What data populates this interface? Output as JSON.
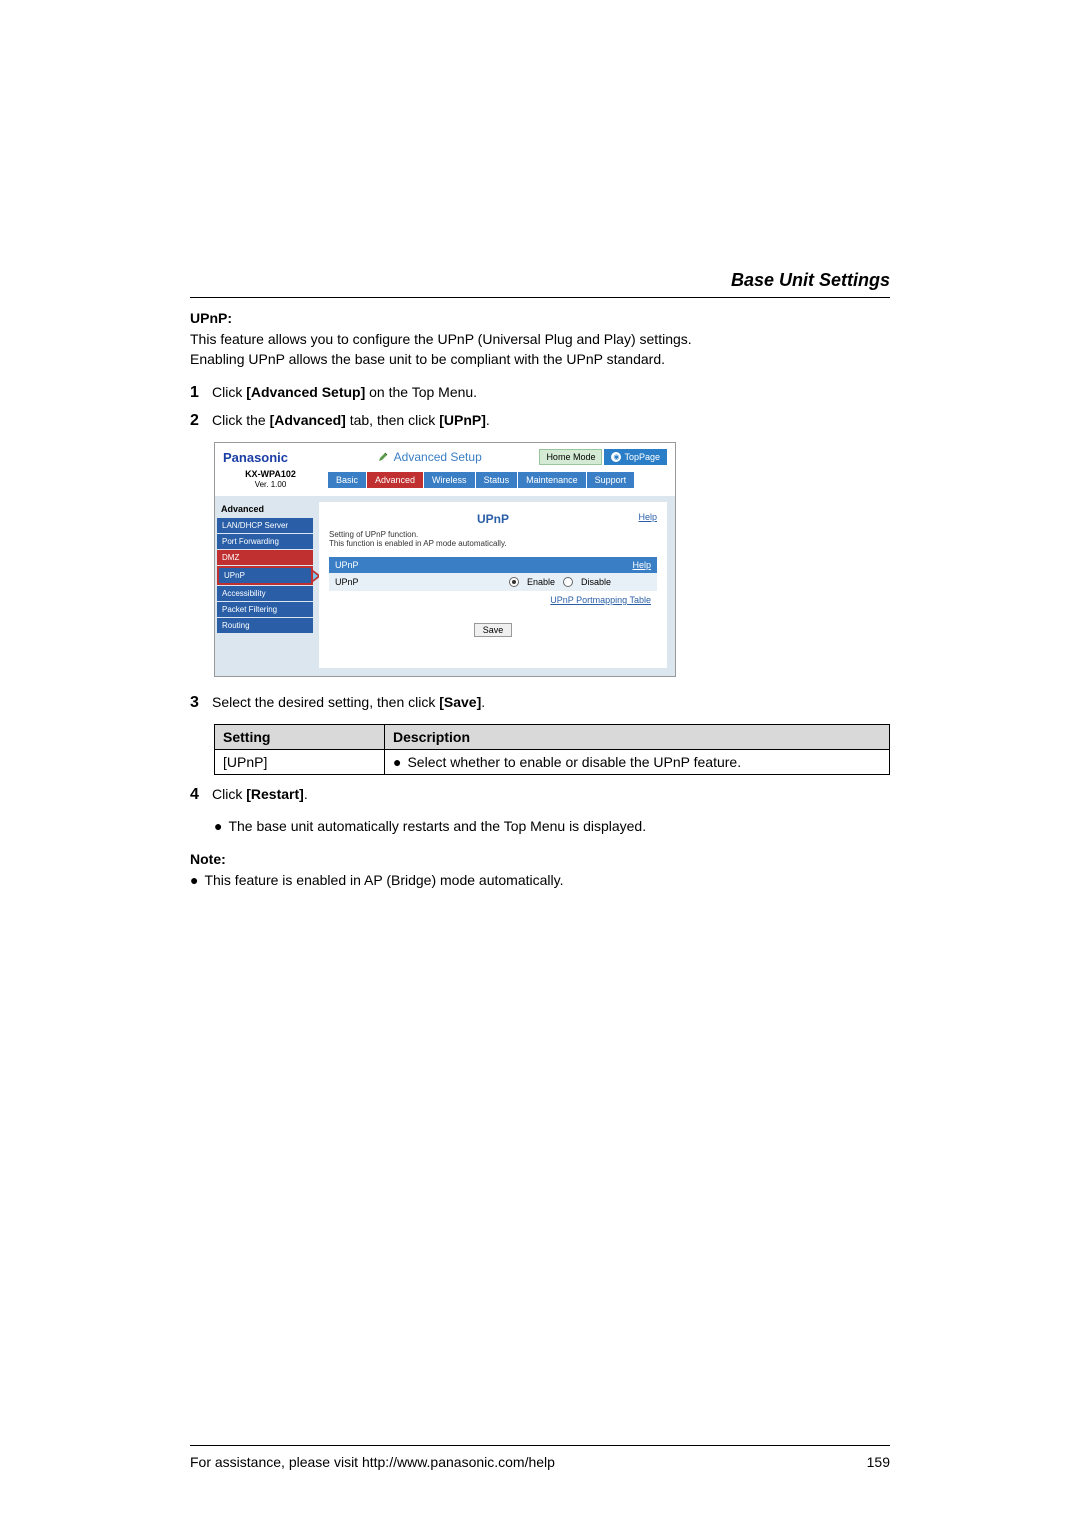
{
  "section_title": "Base Unit Settings",
  "upnp_heading": "UPnP:",
  "intro_line1": "This feature allows you to configure the UPnP (Universal Plug and Play) settings.",
  "intro_line2": "Enabling UPnP allows the base unit to be compliant with the UPnP standard.",
  "steps": {
    "s1_num": "1",
    "s1_pre": "Click ",
    "s1_bold": "[Advanced Setup]",
    "s1_post": " on the Top Menu.",
    "s2_num": "2",
    "s2_pre": "Click the ",
    "s2_bold1": "[Advanced]",
    "s2_mid": " tab, then click ",
    "s2_bold2": "[UPnP]",
    "s2_post": ".",
    "s3_num": "3",
    "s3_pre": "Select the desired setting, then click ",
    "s3_bold": "[Save]",
    "s3_post": ".",
    "s4_num": "4",
    "s4_pre": "Click ",
    "s4_bold": "[Restart]",
    "s4_post": ".",
    "s4_bullet": "The base unit automatically restarts and the Top Menu is displayed."
  },
  "screenshot": {
    "brand": "Panasonic",
    "title": "Advanced Setup",
    "home_mode": "Home Mode",
    "top_page": "TopPage",
    "model": "KX-WPA102",
    "version": "Ver. 1.00",
    "tabs": [
      "Basic",
      "Advanced",
      "Wireless",
      "Status",
      "Maintenance",
      "Support"
    ],
    "active_tab_index": 1,
    "sidebar_title": "Advanced",
    "sidebar_items": [
      "LAN/DHCP Server",
      "Port Forwarding",
      "DMZ",
      "UPnP",
      "Accessibility",
      "Packet Filtering",
      "Routing"
    ],
    "sidebar_red_index": 2,
    "sidebar_selected_index": 3,
    "main_title": "UPnP",
    "help": "Help",
    "desc_line1": "Setting of UPnP function.",
    "desc_line2": "This function is enabled in AP mode automatically.",
    "panel_head": "UPnP",
    "panel_help": "Help",
    "row_label": "UPnP",
    "enable": "Enable",
    "disable": "Disable",
    "portmap": "UPnP Portmapping Table",
    "save": "Save"
  },
  "table": {
    "head_setting": "Setting",
    "head_desc": "Description",
    "row1_setting": "[UPnP]",
    "row1_desc": "Select whether to enable or disable the UPnP feature."
  },
  "note_label": "Note:",
  "note_item": "This feature is enabled in AP (Bridge) mode automatically.",
  "footer_text": "For assistance, please visit http://www.panasonic.com/help",
  "page_num": "159",
  "bullet": "●"
}
